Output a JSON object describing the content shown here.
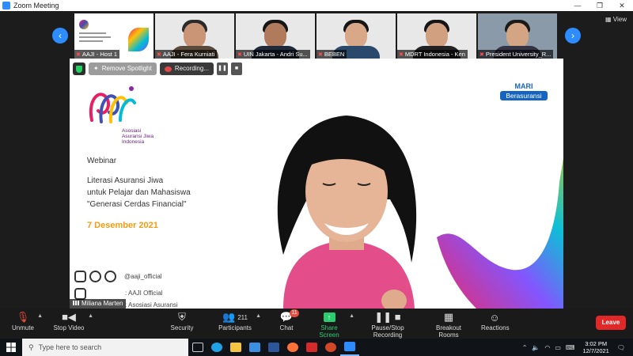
{
  "window": {
    "title": "Zoom Meeting"
  },
  "thumbnails": [
    {
      "label": "AAJI - Host 1",
      "type": "slide"
    },
    {
      "label": "AAJI - Fera Kurniati",
      "type": "person",
      "skin": "#c99576",
      "hair": "#2a2a2a",
      "shirt": "#5a4a3a"
    },
    {
      "label": "UIN Jakarta - Andri Su...",
      "type": "person",
      "skin": "#b07a5c",
      "hair": "#151515",
      "shirt": "#1e2a3a"
    },
    {
      "label": "BEBEN",
      "type": "person",
      "skin": "#d8a889",
      "hair": "#151515",
      "shirt": "#2b4a6b"
    },
    {
      "label": "MDRT Indonesia - Ken",
      "type": "person",
      "skin": "#d0a080",
      "hair": "#151515",
      "shirt": "#222"
    },
    {
      "label": "President University_R...",
      "type": "person",
      "skin": "#d3a584",
      "hair": "#1a1a1a",
      "shirt": "#334"
    }
  ],
  "view_label": "View",
  "spotlight": {
    "remove_label": "Remove Spotlight",
    "recording_label": "Recording...",
    "pause_icon": "❚❚",
    "stop_icon": "■"
  },
  "slide": {
    "org_line1": "Asosiasi",
    "org_line2": "Asuransi Jiwa",
    "org_line3": "Indonesia",
    "heading": "Webinar",
    "line1": "Literasi Asuransi Jiwa",
    "line2": "untuk Pelajar dan Mahasiswa",
    "line3": "\"Generasi Cerdas Financial\"",
    "date": "7 Desember 2021",
    "mari_top": "MARI",
    "mari_bottom": "Berasuransi",
    "social_handle": "@aaji_official",
    "youtube": ": AAJI Official",
    "linkedin": ": Asosiasi Asuransi"
  },
  "speaker_name": "Miliana Marten",
  "toolbar": {
    "unmute": "Unmute",
    "stop_video": "Stop Video",
    "security": "Security",
    "participants": "Participants",
    "participants_count": "211",
    "chat": "Chat",
    "chat_badge": "11",
    "share": "Share Screen",
    "pause_record": "Pause/Stop Recording",
    "breakout": "Breakout Rooms",
    "reactions": "Reactions",
    "leave": "Leave"
  },
  "taskbar": {
    "search_placeholder": "Type here to search",
    "time": "3:02 PM",
    "date": "12/7/2021"
  },
  "colors": {
    "zoom_blue": "#2d8cff",
    "leave_red": "#e02828",
    "share_green": "#2ecc71",
    "date_orange": "#f39c12"
  }
}
